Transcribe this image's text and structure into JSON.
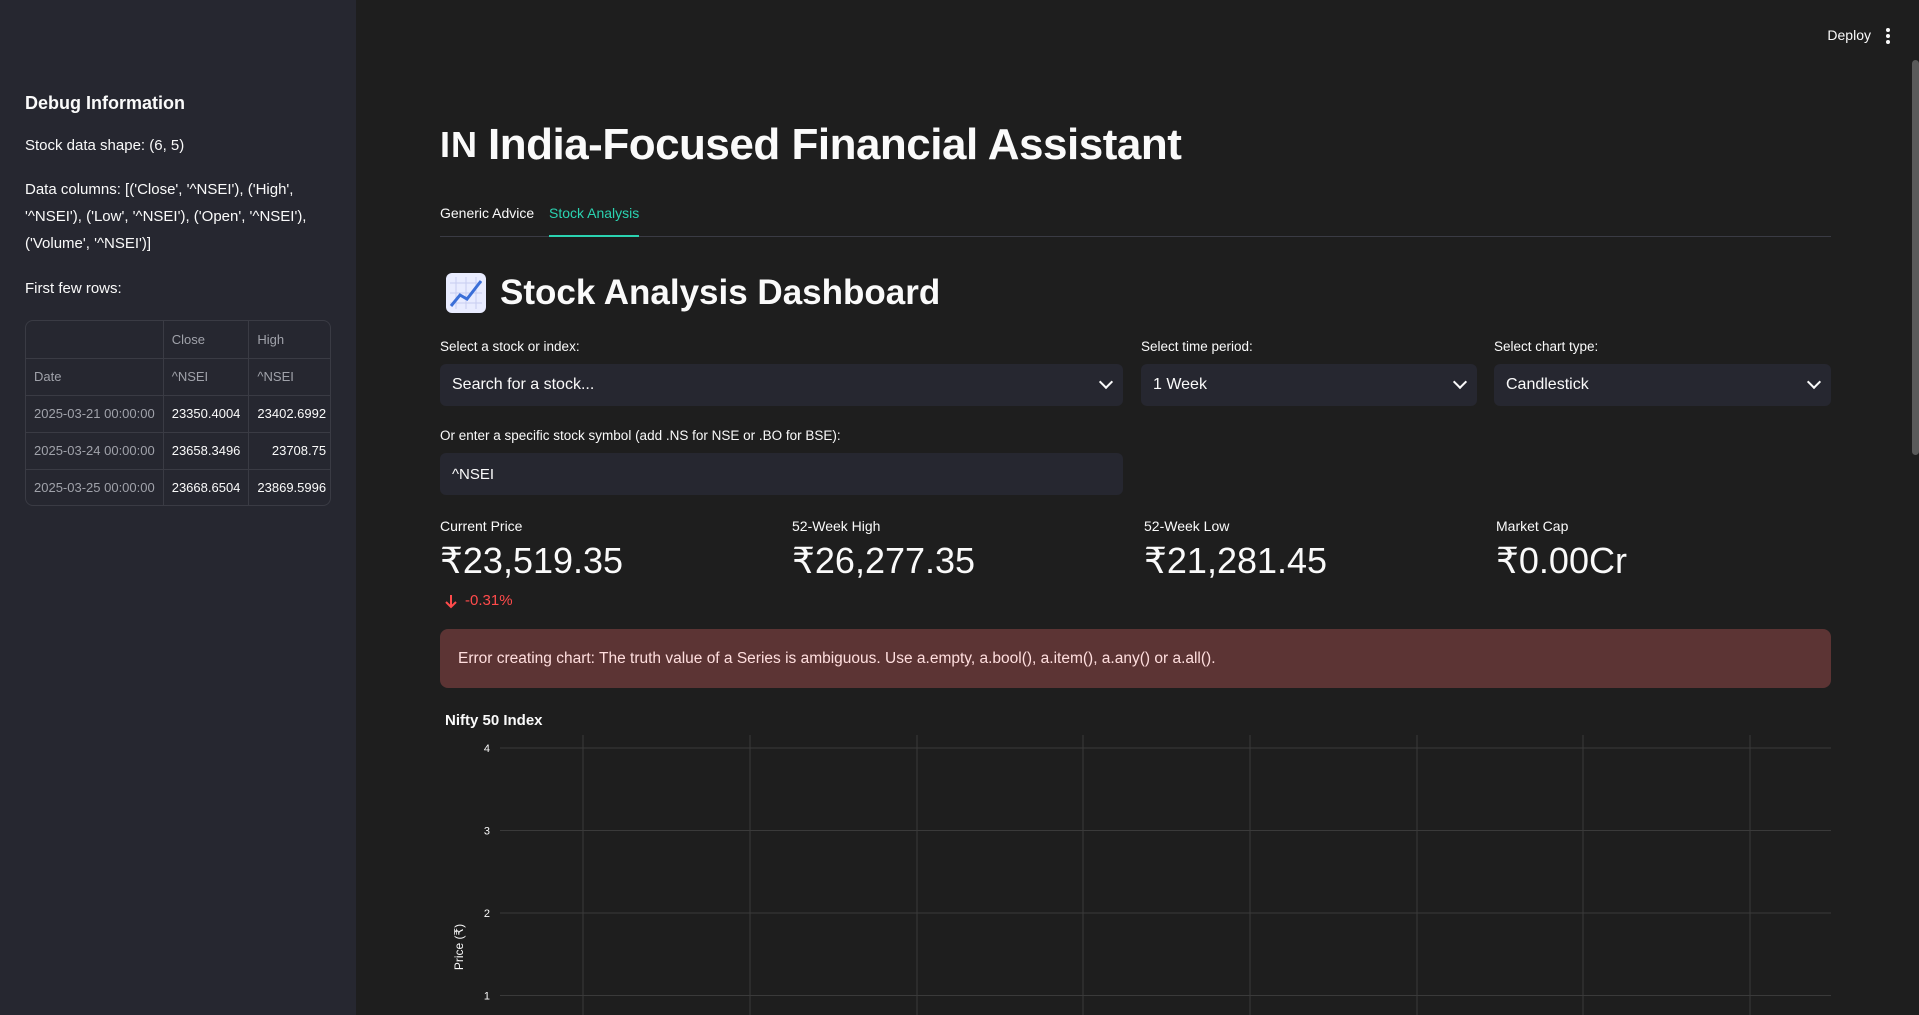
{
  "sidebar": {
    "title": "Debug Information",
    "shape_text": "Stock data shape: (6, 5)",
    "columns_line1": "Data columns: [('Close', '^NSEI'), ('High',",
    "columns_line2": "'^NSEI'), ('Low', '^NSEI'), ('Open', '^NSEI'),",
    "columns_line3": "('Volume', '^NSEI')]",
    "first_rows_label": "First few rows:",
    "table": {
      "header_row1": [
        "",
        "Close",
        "High"
      ],
      "header_row2": [
        "Date",
        "^NSEI",
        "^NSEI"
      ],
      "rows": [
        [
          "2025-03-21 00:00:00",
          "23350.4004",
          "23402.6992"
        ],
        [
          "2025-03-24 00:00:00",
          "23658.3496",
          "23708.75"
        ],
        [
          "2025-03-25 00:00:00",
          "23668.6504",
          "23869.5996"
        ]
      ]
    }
  },
  "header": {
    "deploy_label": "Deploy"
  },
  "main": {
    "title_flag": "IN",
    "title": "India-Focused Financial Assistant",
    "tabs": [
      {
        "label": "Generic Advice"
      },
      {
        "label": "Stock Analysis"
      }
    ],
    "section_title": "Stock Analysis Dashboard",
    "stock_select": {
      "label": "Select a stock or index:",
      "value": "Search for a stock..."
    },
    "period_select": {
      "label": "Select time period:",
      "value": "1 Week"
    },
    "chart_type_select": {
      "label": "Select chart type:",
      "value": "Candlestick"
    },
    "symbol_input": {
      "label": "Or enter a specific stock symbol (add .NS for NSE or .BO for BSE):",
      "value": "^NSEI"
    },
    "metrics": {
      "current_price": {
        "label": "Current Price",
        "value": "₹23,519.35",
        "delta": "-0.31%"
      },
      "high_52": {
        "label": "52-Week High",
        "value": "₹26,277.35"
      },
      "low_52": {
        "label": "52-Week Low",
        "value": "₹21,281.45"
      },
      "market_cap": {
        "label": "Market Cap",
        "value": "₹0.00Cr"
      }
    },
    "error_text": "Error creating chart: The truth value of a Series is ambiguous. Use a.empty, a.bool(), a.item(), a.any() or a.all()."
  },
  "chart_data": {
    "type": "line",
    "title": "Nifty 50 Index",
    "ylabel": "Price (₹)",
    "xlabel": "",
    "yticks": [
      4,
      3,
      2,
      1
    ],
    "ylim": [
      1,
      4
    ],
    "series": [],
    "grid": true
  },
  "colors": {
    "accent": "#2bd3b1",
    "negative": "#ff4b4b",
    "error_bg": "#5c3434",
    "sidebar_bg": "#262730",
    "main_bg": "#1e1e1e"
  }
}
